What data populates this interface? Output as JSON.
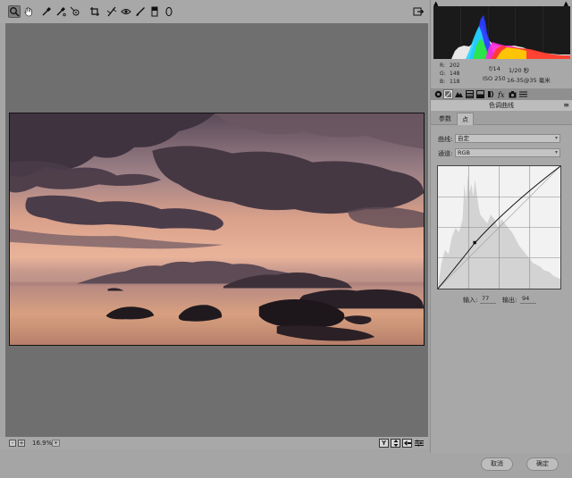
{
  "toolbar": {
    "tools": [
      {
        "name": "zoom-tool",
        "icon": "magnifier-icon",
        "active": true
      },
      {
        "name": "hand-tool",
        "icon": "hand-icon"
      },
      {
        "name": "white-balance-tool",
        "icon": "eyedropper-icon"
      },
      {
        "name": "color-sampler-tool",
        "icon": "color-sampler-icon"
      },
      {
        "name": "target-adjust-tool",
        "icon": "target-adjust-icon"
      },
      {
        "name": "crop-tool",
        "icon": "crop-icon"
      },
      {
        "name": "straighten-tool",
        "icon": "straighten-icon"
      },
      {
        "name": "red-eye-tool",
        "icon": "red-eye-icon"
      },
      {
        "name": "adjustment-brush-tool",
        "icon": "brush-icon"
      },
      {
        "name": "graduated-filter-tool",
        "icon": "graduated-filter-icon"
      },
      {
        "name": "radial-filter-tool",
        "icon": "radial-filter-icon"
      }
    ],
    "open_preferences_icon": "export-icon"
  },
  "status": {
    "zoom": "16.9%",
    "zoom_dropdown": "▾",
    "zoom_minus": "-",
    "zoom_plus": "+",
    "yy_button": "Y"
  },
  "info": {
    "r_label": "R:",
    "r_value": "202",
    "g_label": "G:",
    "g_value": "148",
    "b_label": "B:",
    "b_value": "118",
    "aperture": "f/14",
    "shutter": "1/20 秒",
    "iso": "ISO 250",
    "lens": "16-35@35 毫米"
  },
  "panel": {
    "section_title": "色调曲线",
    "section_menu": "≡",
    "subtabs": [
      "参数",
      "点"
    ],
    "active_subtab": 1,
    "curve_label": "曲线:",
    "curve_value": "自定",
    "channel_label": "通道:",
    "channel_value": "RGB",
    "input_label": "输入:",
    "input_value": "77",
    "output_label": "输出:",
    "output_value": "94"
  },
  "buttons": {
    "cancel": "取消",
    "ok": "确定"
  },
  "colors": {
    "panel_bg": "#a8a8a8",
    "canvas_bg": "#6f6f6f",
    "histogram_bg": "#1a1a1a"
  }
}
